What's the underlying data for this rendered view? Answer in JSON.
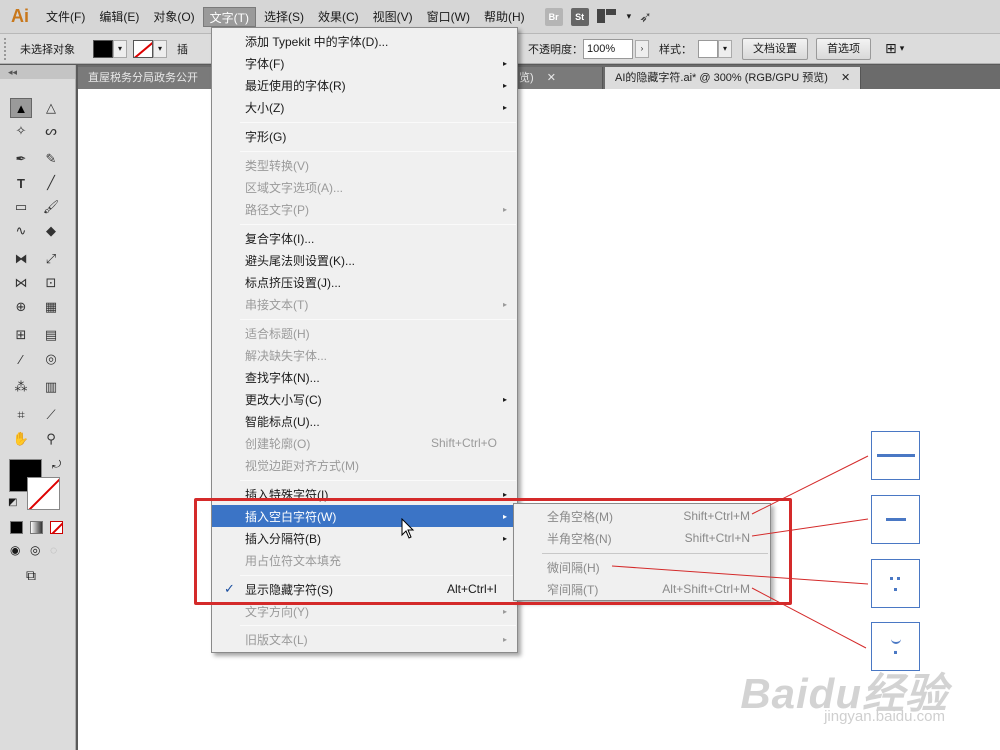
{
  "app": {
    "logo": "Ai"
  },
  "menubar": {
    "items": [
      "文件(F)",
      "编辑(E)",
      "对象(O)",
      "文字(T)",
      "选择(S)",
      "效果(C)",
      "视图(V)",
      "窗口(W)",
      "帮助(H)"
    ],
    "br": "Br",
    "st": "St"
  },
  "control": {
    "no_selection": "未选择对象",
    "opacity_label": "不透明度：",
    "opacity_value": "100%",
    "style_label": "样式：",
    "doc_settings": "文档设置",
    "preferences": "首选项",
    "trunc": "插"
  },
  "tabs": [
    {
      "title": "直屋税务分局政务公开",
      "close": "✕"
    },
    {
      "title": "览)",
      "close": "✕"
    },
    {
      "title": "AI的隐藏字符.ai* @ 300% (RGB/GPU 预览)",
      "close": "✕"
    }
  ],
  "toolbox": {
    "collapse": "◂◂"
  },
  "type_menu": {
    "items": [
      {
        "label": "添加 Typekit 中的字体(D)...",
        "short": "",
        "arrow": ""
      },
      {
        "label": "字体(F)",
        "short": "",
        "arrow": "▸"
      },
      {
        "label": "最近使用的字体(R)",
        "short": "",
        "arrow": "▸"
      },
      {
        "label": "大小(Z)",
        "short": "",
        "arrow": "▸"
      },
      {
        "label": "字形(G)",
        "short": "",
        "arrow": ""
      },
      {
        "label": "类型转换(V)",
        "short": "",
        "arrow": ""
      },
      {
        "label": "区域文字选项(A)...",
        "short": "",
        "arrow": ""
      },
      {
        "label": "路径文字(P)",
        "short": "",
        "arrow": "▸"
      },
      {
        "label": "复合字体(I)...",
        "short": "",
        "arrow": ""
      },
      {
        "label": "避头尾法则设置(K)...",
        "short": "",
        "arrow": ""
      },
      {
        "label": "标点挤压设置(J)...",
        "short": "",
        "arrow": ""
      },
      {
        "label": "串接文本(T)",
        "short": "",
        "arrow": "▸"
      },
      {
        "label": "适合标题(H)",
        "short": "",
        "arrow": ""
      },
      {
        "label": "解决缺失字体...",
        "short": "",
        "arrow": ""
      },
      {
        "label": "查找字体(N)...",
        "short": "",
        "arrow": ""
      },
      {
        "label": "更改大小写(C)",
        "short": "",
        "arrow": "▸"
      },
      {
        "label": "智能标点(U)...",
        "short": "",
        "arrow": ""
      },
      {
        "label": "创建轮廓(O)",
        "short": "Shift+Ctrl+O",
        "arrow": ""
      },
      {
        "label": "视觉边距对齐方式(M)",
        "short": "",
        "arrow": ""
      },
      {
        "label": "插入特殊字符(I)",
        "short": "",
        "arrow": "▸"
      },
      {
        "label": "插入空白字符(W)",
        "short": "",
        "arrow": "▸"
      },
      {
        "label": "插入分隔符(B)",
        "short": "",
        "arrow": "▸"
      },
      {
        "label": "用占位符文本填充",
        "short": "",
        "arrow": ""
      },
      {
        "label": "显示隐藏字符(S)",
        "short": "Alt+Ctrl+I",
        "arrow": ""
      },
      {
        "label": "文字方向(Y)",
        "short": "",
        "arrow": "▸"
      },
      {
        "label": "旧版文本(L)",
        "short": "",
        "arrow": "▸"
      }
    ],
    "check_mark": "✓"
  },
  "whitespace_submenu": {
    "items": [
      {
        "label": "全角空格(M)",
        "short": "Shift+Ctrl+M"
      },
      {
        "label": "半角空格(N)",
        "short": "Shift+Ctrl+N"
      },
      {
        "label": "微间隔(H)",
        "short": ""
      },
      {
        "label": "窄间隔(T)",
        "short": "Alt+Shift+Ctrl+M"
      }
    ]
  },
  "watermark": {
    "brand": "Baidu经验",
    "url": "jingyan.baidu.com"
  },
  "colors": {
    "highlight": "#3b74c6",
    "annotation_red": "#d42a2a",
    "illustration_blue": "#4a78c4"
  }
}
